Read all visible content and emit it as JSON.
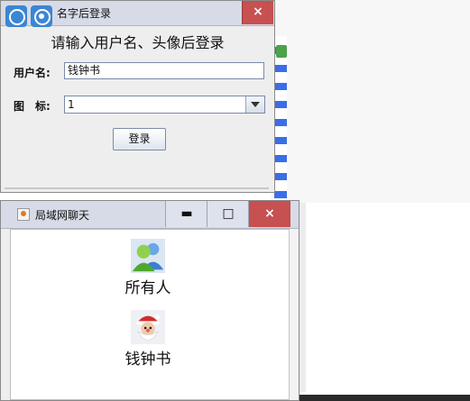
{
  "login_dialog": {
    "title": "名字后登录",
    "heading": "请输入用户名、头像后登录",
    "username_label": "用户名:",
    "username_value": "钱钟书",
    "icon_label": "图　标:",
    "icon_value": "1",
    "login_button": "登录",
    "close_glyph": "×"
  },
  "chat_window": {
    "title": "局域网聊天",
    "minimize_glyph": "▬",
    "maximize_glyph": "□",
    "close_glyph": "×",
    "users": [
      {
        "name": "所有人",
        "icon": "group-icon"
      },
      {
        "name": "钱钟书",
        "icon": "santa-avatar-icon"
      }
    ]
  },
  "colors": {
    "titlebar": "#d6dbe7",
    "close_red": "#c75050",
    "overlay_blue": "#3b86d4"
  }
}
